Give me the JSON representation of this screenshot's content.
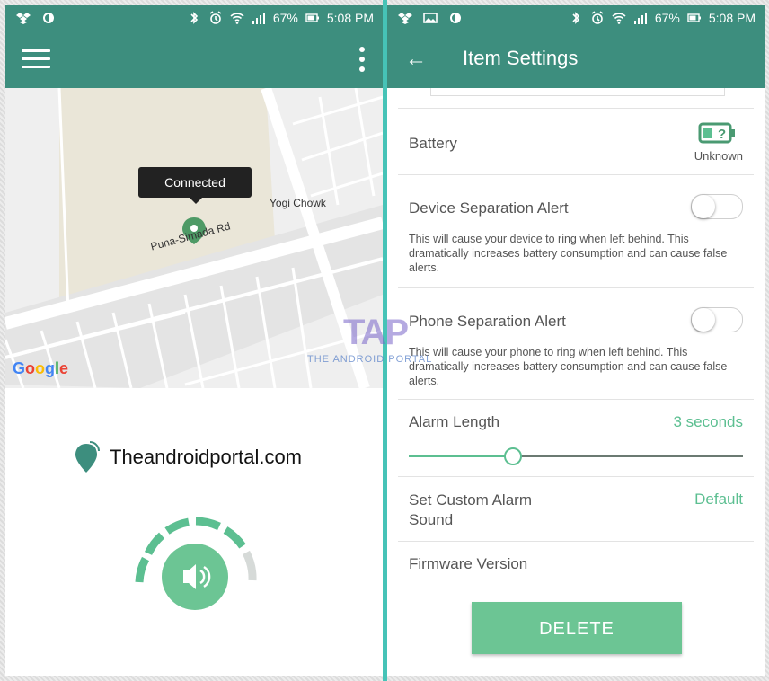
{
  "status": {
    "battery_pct": "67%",
    "time": "5:08 PM"
  },
  "left": {
    "map": {
      "tooltip": "Connected",
      "labels": {
        "chowk": "Yogi Chowk",
        "road": "Puna-Simada Rd"
      },
      "google_letters": [
        "G",
        "o",
        "o",
        "g",
        "l",
        "e"
      ],
      "google_colors": [
        "#4285f4",
        "#ea4335",
        "#fbbc05",
        "#4285f4",
        "#34a853",
        "#ea4335"
      ]
    },
    "brand": "Theandroidportal.com",
    "accent": "#3d8e7e",
    "button_color": "#6cc594"
  },
  "right": {
    "title": "Item Settings",
    "battery": {
      "label": "Battery",
      "status": "Unknown"
    },
    "device_sep": {
      "label": "Device Separation Alert",
      "desc": "This will cause your device to ring when left behind. This dramatically increases battery consumption and can cause false alerts.",
      "enabled": false
    },
    "phone_sep": {
      "label": "Phone Separation Alert",
      "desc": "This will cause your phone to ring when left behind. This dramatically increases battery consumption and can cause false alerts.",
      "enabled": false
    },
    "alarm_length": {
      "label": "Alarm Length",
      "value": "3 seconds",
      "slider_fraction": 0.31
    },
    "custom_sound": {
      "label": "Set Custom Alarm Sound",
      "value": "Default"
    },
    "firmware": {
      "label": "Firmware Version"
    },
    "delete_label": "DELETE"
  },
  "watermark": {
    "logo": "TAP",
    "caption": "THE ANDROID PORTAL"
  }
}
